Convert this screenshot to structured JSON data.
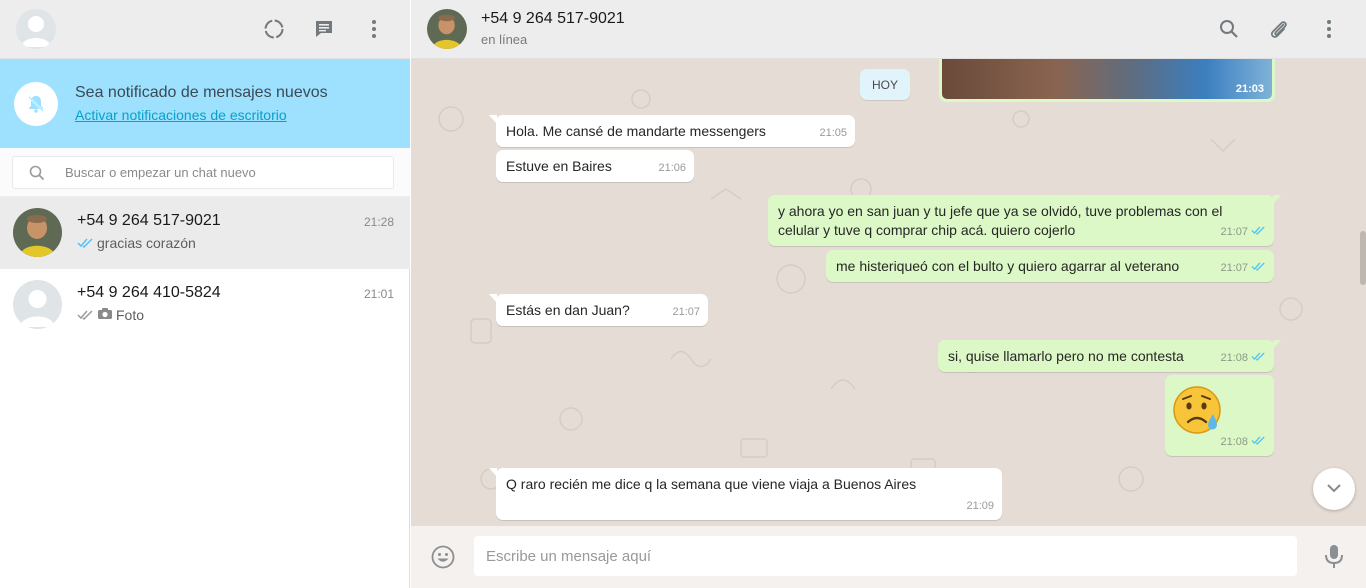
{
  "sidebar": {
    "notification": {
      "title": "Sea notificado de mensajes nuevos",
      "link": "Activar notificaciones de escritorio"
    },
    "search": {
      "placeholder": "Buscar o empezar un chat nuevo"
    },
    "chats": [
      {
        "name": "+54 9 264 517-9021",
        "time": "21:28",
        "preview": "gracias corazón",
        "ticks": "read"
      },
      {
        "name": "+54 9 264 410-5824",
        "time": "21:01",
        "preview": "Foto",
        "ticks": "sent"
      }
    ]
  },
  "conversation": {
    "contact_name": "+54 9 264 517-9021",
    "status": "en línea",
    "day_label": "HOY",
    "photo_time": "21:03",
    "messages": [
      {
        "dir": "in",
        "text": "Hola.  Me cansé de mandarte messengers",
        "time": "21:05"
      },
      {
        "dir": "in",
        "text": "Estuve en Baires",
        "time": "21:06"
      },
      {
        "dir": "out",
        "text_line1": "y ahora yo en san juan y tu jefe que ya se olvidó, tuve problemas con el",
        "text_line2": "celular y tuve q comprar chip acá. quiero cojerlo",
        "time": "21:07"
      },
      {
        "dir": "out",
        "text": "me histeriqueó con el bulto y quiero agarrar al veterano",
        "time": "21:07"
      },
      {
        "dir": "in",
        "text": "Estás en dan Juan?",
        "time": "21:07"
      },
      {
        "dir": "out",
        "text": "si, quise llamarlo pero no me contesta",
        "time": "21:08"
      },
      {
        "dir": "out",
        "text": "😥",
        "time": "21:08"
      },
      {
        "dir": "in",
        "text": "Q raro recién me dice q la semana que viene viaja a Buenos Aires",
        "time": "21:09"
      }
    ]
  },
  "composer": {
    "placeholder": "Escribe un mensaje aquí"
  },
  "colors": {
    "outgoing_bubble": "#dcf8c6",
    "incoming_bubble": "#ffffff",
    "read_ticks": "#4fc3f7",
    "notify_banner": "#9de1fe"
  }
}
